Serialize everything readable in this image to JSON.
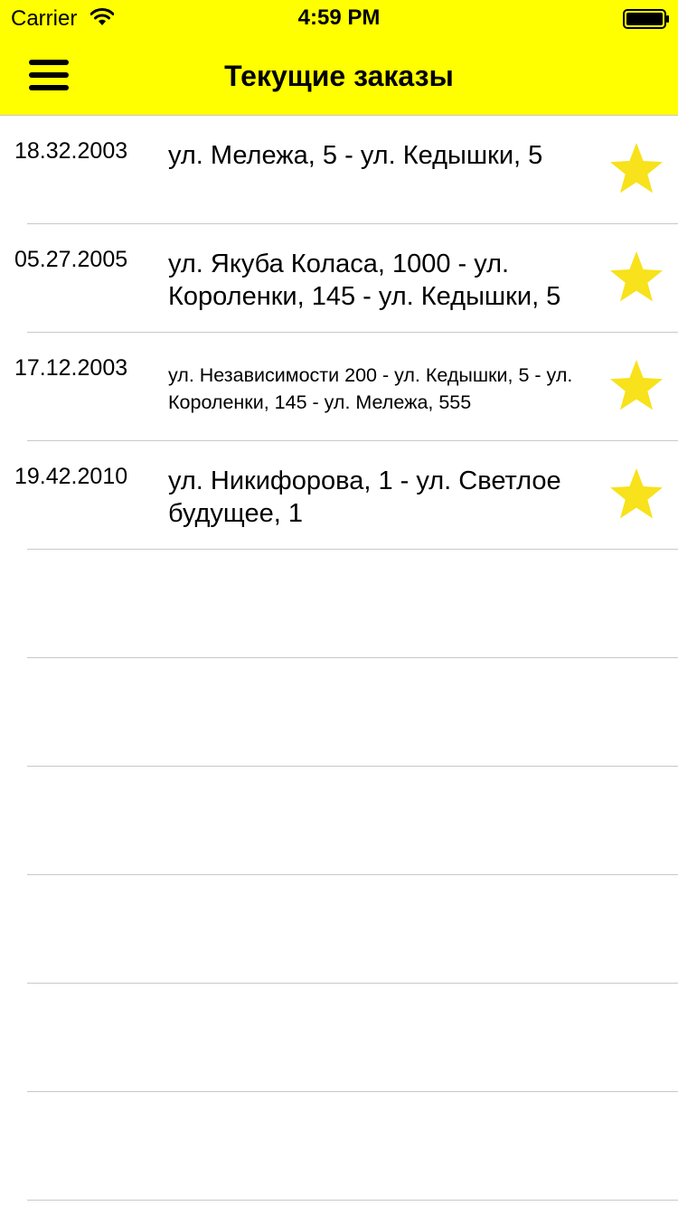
{
  "status_bar": {
    "carrier": "Carrier",
    "time": "4:59 PM"
  },
  "nav": {
    "title": "Текущие заказы",
    "menu_icon": "hamburger-menu-icon"
  },
  "colors": {
    "header_bg": "#ffff00",
    "star": "#f7e21b",
    "separator": "#c8c7cc"
  },
  "orders": [
    {
      "date": "18.32.2003",
      "route": "ул. Мележа, 5 - ул. Кедышки, 5",
      "icon": "star-icon"
    },
    {
      "date": "05.27.2005",
      "route": "ул. Якуба Коласа, 1000 - ул. Короленки, 145 - ул. Кедышки, 5",
      "icon": "star-icon"
    },
    {
      "date": "17.12.2003",
      "route": "ул. Независимости 200 - ул. Кедышки, 5 - ул. Короленки, 145 - ул. Мележа, 555",
      "icon": "star-icon"
    },
    {
      "date": "19.42.2010",
      "route": "ул. Никифорова, 1 - ул. Светлое будущее, 1",
      "icon": "star-icon"
    }
  ]
}
